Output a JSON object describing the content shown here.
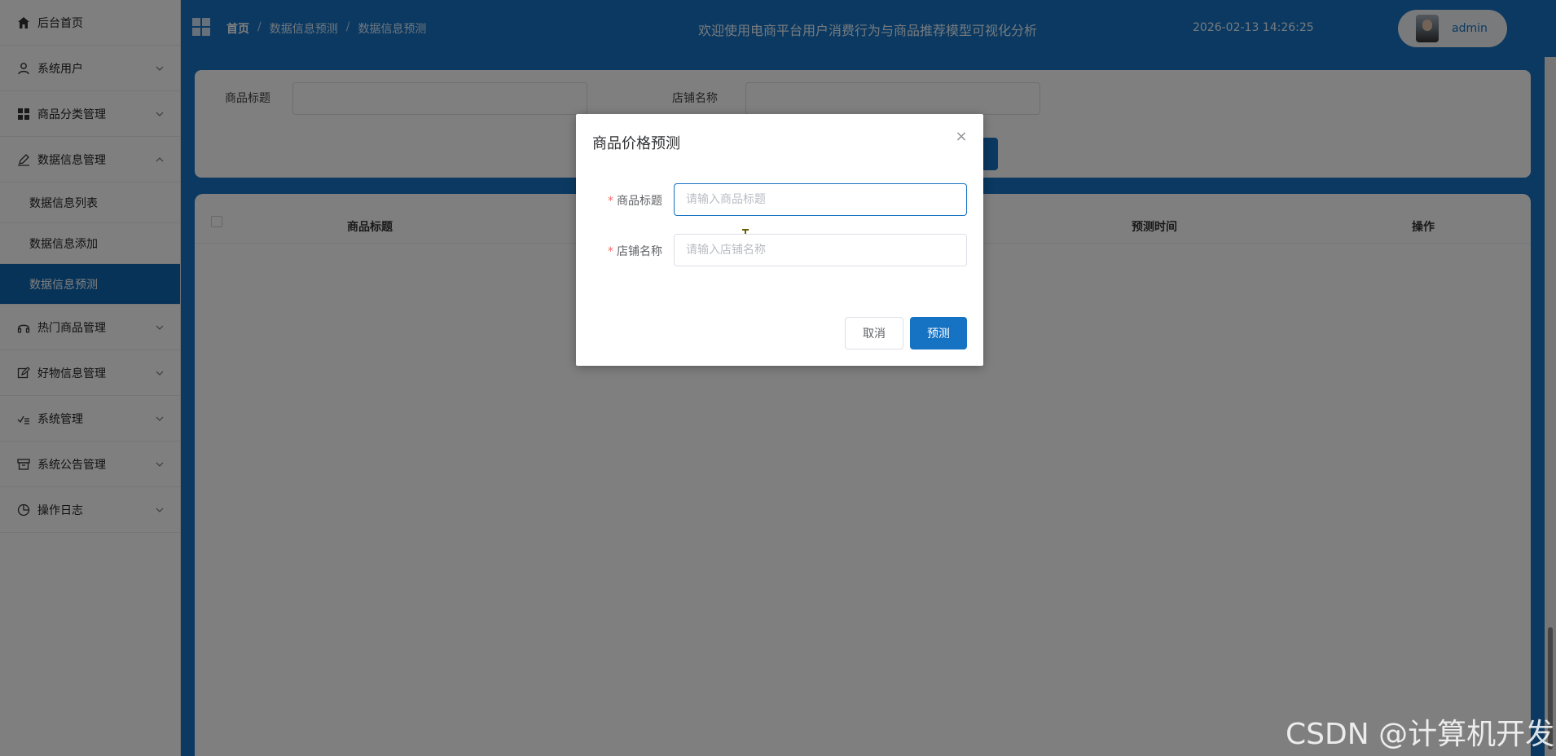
{
  "sidebar": {
    "items": [
      {
        "label": "后台首页",
        "icon": "home-icon"
      },
      {
        "label": "系统用户",
        "icon": "user-icon"
      },
      {
        "label": "商品分类管理",
        "icon": "grid-icon"
      },
      {
        "label": "数据信息管理",
        "icon": "edit-icon"
      },
      {
        "label": "热门商品管理",
        "icon": "headphones-icon"
      },
      {
        "label": "好物信息管理",
        "icon": "pencil-square-icon"
      },
      {
        "label": "系统管理",
        "icon": "settings-check-icon"
      },
      {
        "label": "系统公告管理",
        "icon": "archive-icon"
      },
      {
        "label": "操作日志",
        "icon": "pie-clock-icon"
      }
    ],
    "submenu": [
      {
        "label": "数据信息列表"
      },
      {
        "label": "数据信息添加"
      },
      {
        "label": "数据信息预测"
      }
    ]
  },
  "topbar": {
    "breadcrumb": [
      "首页",
      "数据信息预测",
      "数据信息预测"
    ],
    "separator": "/",
    "title": "欢迎使用电商平台用户消费行为与商品推荐模型可视化分析",
    "datetime": "2026-02-13 14:26:25",
    "user": "admin"
  },
  "search": {
    "label1": "商品标题",
    "label2": "店铺名称"
  },
  "table": {
    "headers": [
      "商品标题",
      "预测时间",
      "操作"
    ]
  },
  "dialog": {
    "title": "商品价格预测",
    "close": "×",
    "fields": [
      {
        "label": "商品标题",
        "placeholder": "请输入商品标题",
        "required": "*"
      },
      {
        "label": "店铺名称",
        "placeholder": "请输入店铺名称",
        "required": "*"
      }
    ],
    "cancel": "取消",
    "submit": "预测"
  },
  "watermark": "CSDN @计算机开发",
  "colors": {
    "primary": "#1672c2",
    "active_menu": "#0f67b1",
    "overlay": "rgba(0,0,0,0.5)",
    "required": "#f56c6c"
  }
}
